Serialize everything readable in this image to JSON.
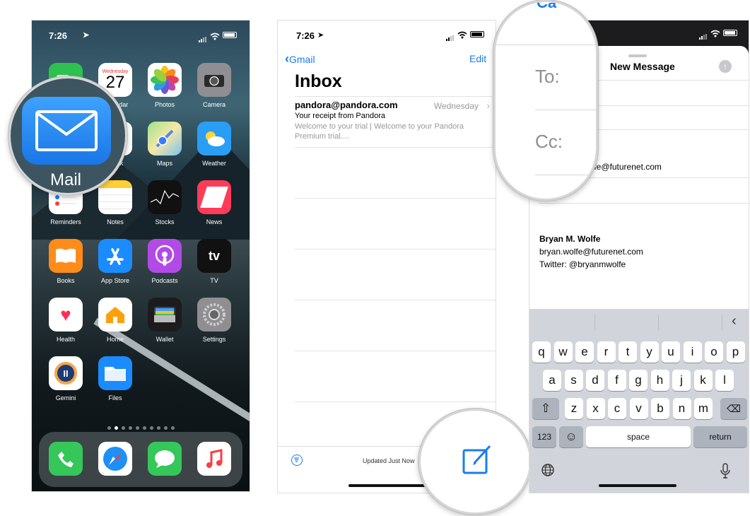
{
  "home": {
    "time": "7:26",
    "apps": [
      {
        "label": "FaceTime",
        "color": "#2fc14f"
      },
      {
        "label": "Calendar",
        "day": "Wednesday",
        "date": "27"
      },
      {
        "label": "Photos"
      },
      {
        "label": "Camera",
        "color": "#8e8e93"
      },
      {
        "label": "Mail",
        "color": "#1e8ff7"
      },
      {
        "label": "Clock"
      },
      {
        "label": "Maps"
      },
      {
        "label": "Weather",
        "color": "#2a9df4"
      },
      {
        "label": "Reminders"
      },
      {
        "label": "Notes"
      },
      {
        "label": "Stocks"
      },
      {
        "label": "News",
        "color": "#ff3b58"
      },
      {
        "label": "Books",
        "color": "#ff8c1a"
      },
      {
        "label": "App Store",
        "color": "#1a8cff"
      },
      {
        "label": "Podcasts",
        "color": "#b24be6"
      },
      {
        "label": "TV",
        "color": "#111111",
        "glyph": "tv"
      },
      {
        "label": "Health"
      },
      {
        "label": "Home"
      },
      {
        "label": "Wallet",
        "color": "#1c1c1e"
      },
      {
        "label": "Settings",
        "color": "#8e8e93"
      },
      {
        "label": "Gemini",
        "glyph": "II"
      },
      {
        "label": "Files",
        "color": "#1a8cff"
      }
    ],
    "dock": [
      {
        "label": "Phone",
        "color": "#35c759"
      },
      {
        "label": "Safari"
      },
      {
        "label": "Messages",
        "color": "#35c759"
      },
      {
        "label": "Music"
      }
    ],
    "magnifier_label": "Mail"
  },
  "inbox": {
    "time": "7:26",
    "back_label": "Gmail",
    "edit_label": "Edit",
    "title": "Inbox",
    "messages": [
      {
        "sender": "pandora@pandora.com",
        "date": "Wednesday",
        "subject": "Your receipt from Pandora",
        "preview": "Welcome to your trial | Welcome to your Pandora Premium trial...."
      }
    ],
    "status": "Updated Just Now"
  },
  "compose": {
    "title": "New Message",
    "to_label": "To:",
    "cc_label": "Cc:",
    "partial_email": "olfe@futurenet.com",
    "signature": {
      "name": "Bryan M. Wolfe",
      "email": "bryan.wolfe@futurenet.com",
      "twitter": "Twitter: @bryanmwolfe"
    },
    "keyboard": {
      "row1": [
        "q",
        "w",
        "e",
        "r",
        "t",
        "y",
        "u",
        "i",
        "o",
        "p"
      ],
      "row2": [
        "a",
        "s",
        "d",
        "f",
        "g",
        "h",
        "j",
        "k",
        "l"
      ],
      "row3": [
        "z",
        "x",
        "c",
        "v",
        "b",
        "n",
        "m"
      ],
      "numbers_key": "123",
      "space_key": "space",
      "return_key": "return"
    },
    "accent": "#1a7cf0"
  }
}
